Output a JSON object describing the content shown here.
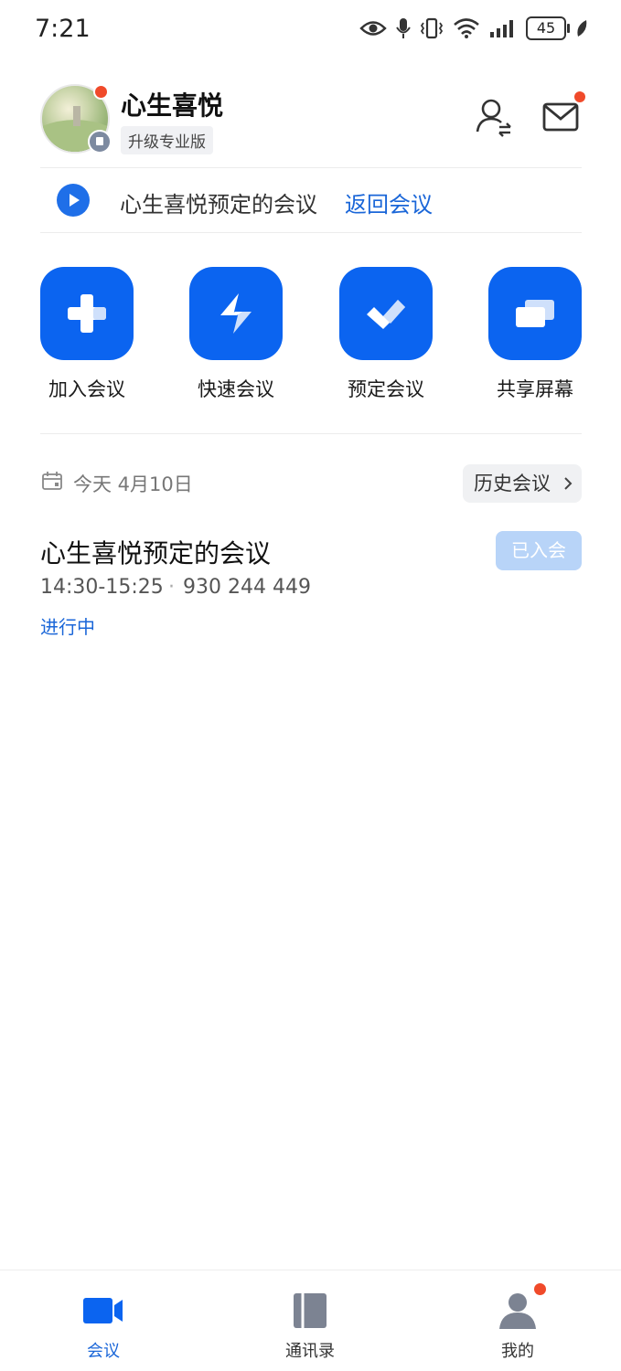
{
  "status_bar": {
    "time": "7:21",
    "battery": "45",
    "icons": [
      "eye-icon",
      "mic-icon",
      "vibrate-icon",
      "wifi-icon",
      "signal-icon",
      "battery-icon",
      "leaf-icon"
    ]
  },
  "header": {
    "user_name": "心生喜悦",
    "upgrade_label": "升级专业版",
    "has_avatar_notification": true,
    "has_mail_notification": true
  },
  "banner": {
    "text": "心生喜悦预定的会议",
    "link_label": "返回会议"
  },
  "actions": [
    {
      "label": "加入会议",
      "icon": "plus-icon"
    },
    {
      "label": "快速会议",
      "icon": "lightning-icon"
    },
    {
      "label": "预定会议",
      "icon": "check-icon"
    },
    {
      "label": "共享屏幕",
      "icon": "screen-share-icon"
    }
  ],
  "date_row": {
    "date_label": "今天 4月10日",
    "history_label": "历史会议"
  },
  "meetings": [
    {
      "title": "心生喜悦预定的会议",
      "time": "14:30-15:25",
      "separator": "·",
      "meeting_id": "930 244 449",
      "status": "进行中",
      "button_label": "已入会"
    }
  ],
  "bottom_nav": [
    {
      "label": "会议",
      "icon": "video-icon",
      "active": true
    },
    {
      "label": "通讯录",
      "icon": "contacts-book-icon",
      "active": false
    },
    {
      "label": "我的",
      "icon": "profile-icon",
      "active": false,
      "has_notification": true
    }
  ],
  "colors": {
    "accent": "#0b64f0",
    "link": "#1a66d8",
    "notification": "#f04a2a",
    "joined_button": "#b8d4f8"
  }
}
